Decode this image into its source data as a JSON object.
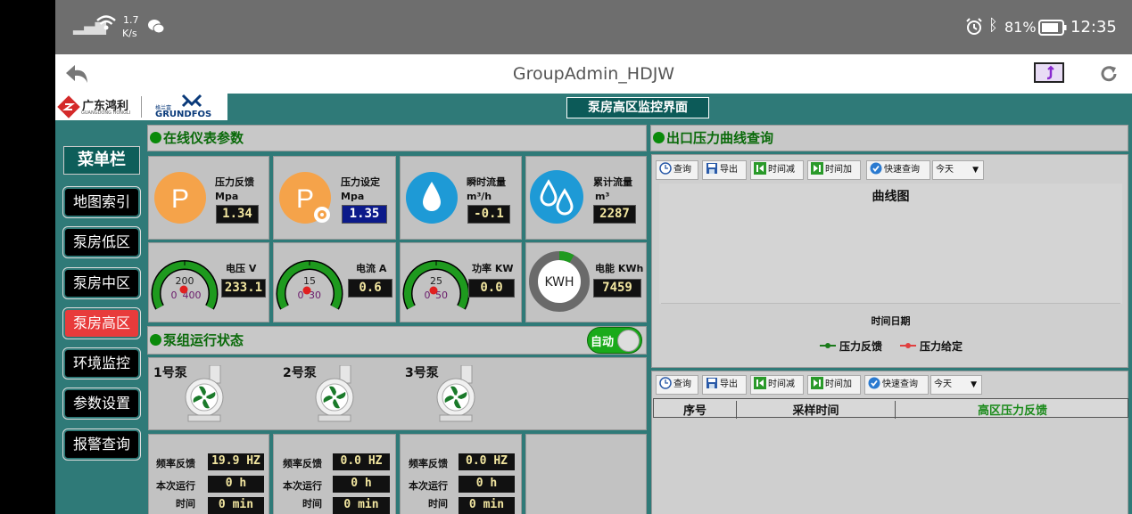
{
  "statusbar": {
    "net_speed": "1.7",
    "net_unit": "K/s",
    "battery": "81%",
    "time": "12:35"
  },
  "titlebar": {
    "title": "GroupAdmin_HDJW"
  },
  "header": {
    "logo_left_text": "广东鸿利",
    "logo_left_sub": "GUANGDONG HONGLI",
    "logo_right_cn": "格兰富",
    "logo_right_text": "GRUNDFOS",
    "page_title": "泵房高区监控界面"
  },
  "menu": {
    "title": "菜单栏",
    "items": [
      {
        "label": "地图索引"
      },
      {
        "label": "泵房低区"
      },
      {
        "label": "泵房中区"
      },
      {
        "label": "泵房高区"
      },
      {
        "label": "环境监控"
      },
      {
        "label": "参数设置"
      },
      {
        "label": "报警查询"
      }
    ]
  },
  "instruments": {
    "title": "在线仪表参数",
    "tiles": [
      {
        "name": "压力反馈",
        "unit": "Mpa",
        "value": "1.34",
        "icon": "P"
      },
      {
        "name": "压力设定",
        "unit": "Mpa",
        "value": "1.35",
        "icon": "P"
      },
      {
        "name": "瞬时流量",
        "unit": "m³/h",
        "value": "-0.1"
      },
      {
        "name": "累计流量",
        "unit": "m³",
        "value": "2287"
      }
    ],
    "gauges": [
      {
        "name": "电压 V",
        "value": "233.1",
        "center": "200",
        "min": "0",
        "max": "400"
      },
      {
        "name": "电流 A",
        "value": "0.6",
        "center": "15",
        "min": "0",
        "max": "30"
      },
      {
        "name": "功率 KW",
        "value": "0.0",
        "center": "25",
        "min": "0",
        "max": "50"
      },
      {
        "name": "电能 KWh",
        "value": "7459",
        "ring_text": "KWH"
      }
    ]
  },
  "pumps": {
    "title": "泵组运行状态",
    "mode_label": "自动",
    "units": [
      {
        "name": "1号泵"
      },
      {
        "name": "2号泵"
      },
      {
        "name": "3号泵"
      }
    ],
    "stats": [
      {
        "freq_label": "频率反馈",
        "freq": "19.9 HZ",
        "run_label_1": "本次运行",
        "run_time": "0 h",
        "run_label_2": "时间",
        "run_min": "0 min"
      },
      {
        "freq_label": "频率反馈",
        "freq": "0.0 HZ",
        "run_label_1": "本次运行",
        "run_time": "0 h",
        "run_label_2": "时间",
        "run_min": "0 min"
      },
      {
        "freq_label": "频率反馈",
        "freq": "0.0 HZ",
        "run_label_1": "本次运行",
        "run_time": "0 h",
        "run_label_2": "时间",
        "run_min": "0 min"
      }
    ]
  },
  "curve": {
    "title": "出口压力曲线查询",
    "toolbar": {
      "query": "查询",
      "export": "导出",
      "time_minus": "时间减",
      "time_plus": "时间加",
      "quick_query": "快速查询",
      "range": "今天"
    },
    "chart_title": "曲线图",
    "x_axis_label": "时间日期",
    "legend": [
      {
        "name": "压力反馈",
        "color": "#1a7a1a"
      },
      {
        "name": "压力给定",
        "color": "#e04040"
      }
    ]
  },
  "table": {
    "toolbar": {
      "query": "查询",
      "export": "导出",
      "time_minus": "时间减",
      "time_plus": "时间加",
      "quick_query": "快速查询",
      "range": "今天"
    },
    "columns": [
      "序号",
      "采样时间",
      "高区压力反馈"
    ]
  },
  "colors": {
    "accent_green": "#0a8a0a",
    "active_red": "#e83b3b",
    "teal_bg": "#2f7a78"
  }
}
